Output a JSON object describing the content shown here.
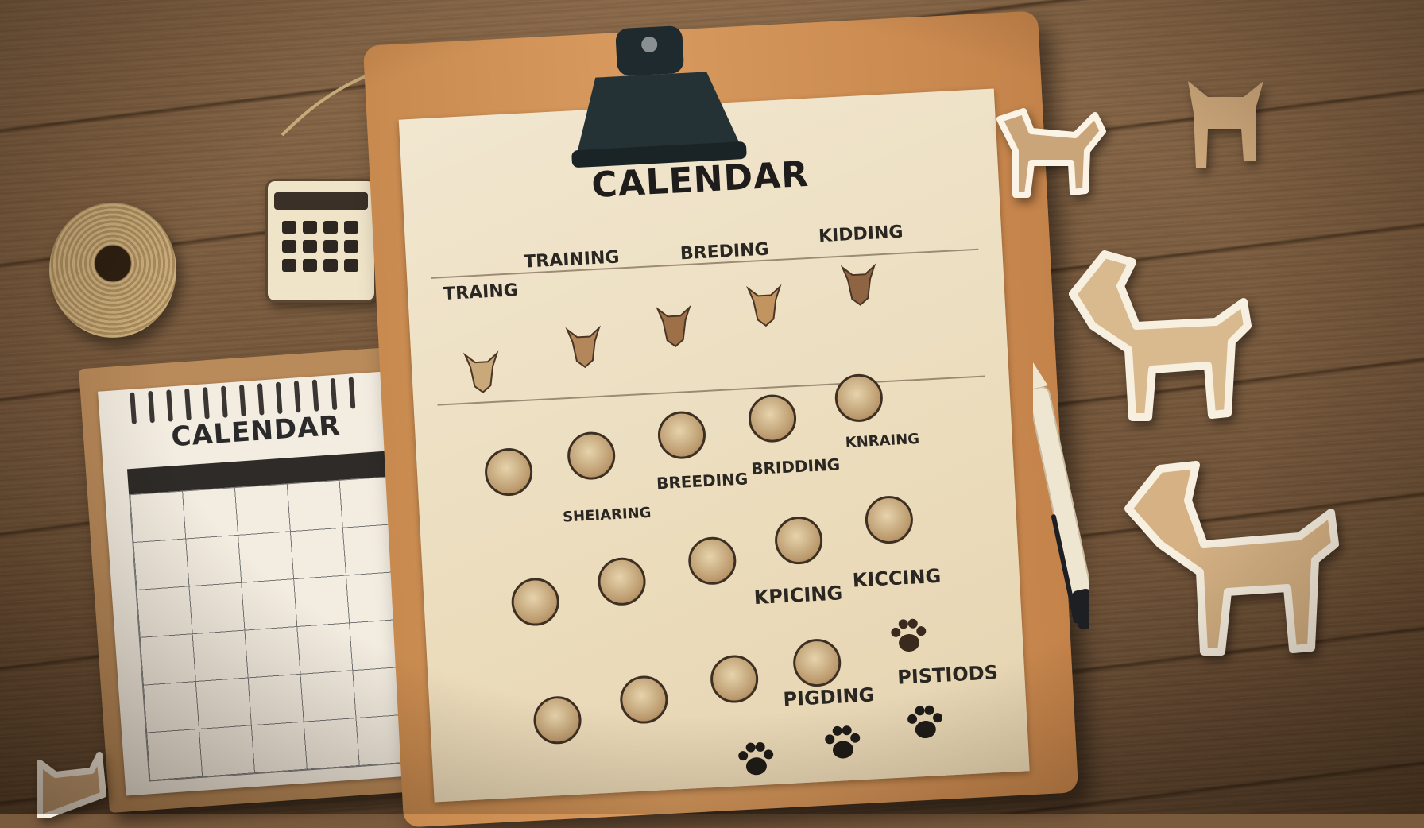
{
  "clipboard": {
    "title": "CALENDAR",
    "header_labels": [
      "TRAINING",
      "BREDING",
      "KIDDING"
    ],
    "row_labels_left": [
      "TRAING"
    ],
    "middle_labels": [
      "BREEDING",
      "BRIDDING",
      "SHEIARING",
      "KNRAING"
    ],
    "lower_labels": [
      "KPICING",
      "KICCING"
    ],
    "bottom_labels": [
      "PIGDING",
      "PISTIODS"
    ]
  },
  "notepad": {
    "title": "CALENDAR"
  },
  "colors": {
    "desk": "#7a5a3d",
    "paper": "#efe3c8",
    "clipboard": "#d39658",
    "clip": "#1f2a2e"
  }
}
